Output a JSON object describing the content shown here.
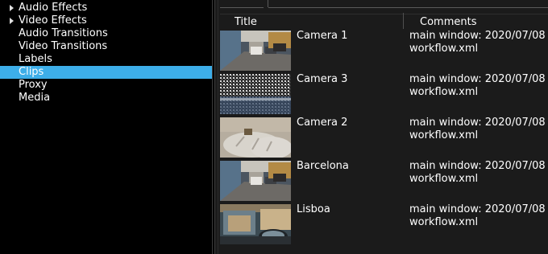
{
  "tree": [
    {
      "label": "Audio Effects",
      "expandable": true
    },
    {
      "label": "Video Effects",
      "expandable": true
    },
    {
      "label": "Audio Transitions",
      "expandable": false
    },
    {
      "label": "Video Transitions",
      "expandable": false
    },
    {
      "label": "Labels",
      "expandable": false
    },
    {
      "label": "Clips",
      "expandable": false,
      "selected": true
    },
    {
      "label": "Proxy",
      "expandable": false
    },
    {
      "label": "Media",
      "expandable": false
    }
  ],
  "columns": {
    "title": "Title",
    "comments": "Comments"
  },
  "clips": [
    {
      "title": "Camera 1",
      "comment_line1": "main window: 2020/07/08",
      "comment_line2": "workflow.xml",
      "thumbnail": "street-with-cars"
    },
    {
      "title": "Camera 3",
      "comment_line1": "main window: 2020/07/08",
      "comment_line2": "workflow.xml",
      "thumbnail": "snowy-pebbles"
    },
    {
      "title": "Camera 2",
      "comment_line1": "main window: 2020/07/08",
      "comment_line2": "workflow.xml",
      "thumbnail": "pillow-on-bed"
    },
    {
      "title": "Barcelona",
      "comment_line1": "main window: 2020/07/08",
      "comment_line2": "workflow.xml",
      "thumbnail": "street-with-cars"
    },
    {
      "title": "Lisboa",
      "comment_line1": "main window: 2020/07/08",
      "comment_line2": "workflow.xml",
      "thumbnail": "car-mirror-street"
    }
  ],
  "colors": {
    "selection": "#3daee9",
    "panel_bg": "#000000",
    "list_bg": "#1b1b1b"
  }
}
